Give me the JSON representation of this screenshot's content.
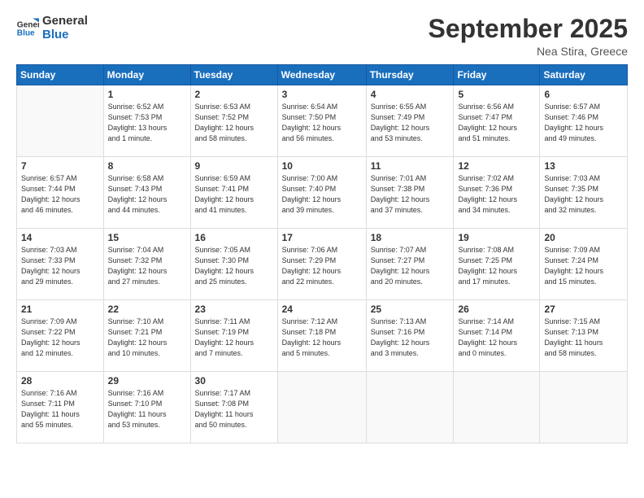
{
  "header": {
    "logo_line1": "General",
    "logo_line2": "Blue",
    "month": "September 2025",
    "location": "Nea Stira, Greece"
  },
  "weekdays": [
    "Sunday",
    "Monday",
    "Tuesday",
    "Wednesday",
    "Thursday",
    "Friday",
    "Saturday"
  ],
  "weeks": [
    [
      {
        "day": "",
        "info": ""
      },
      {
        "day": "1",
        "info": "Sunrise: 6:52 AM\nSunset: 7:53 PM\nDaylight: 13 hours\nand 1 minute."
      },
      {
        "day": "2",
        "info": "Sunrise: 6:53 AM\nSunset: 7:52 PM\nDaylight: 12 hours\nand 58 minutes."
      },
      {
        "day": "3",
        "info": "Sunrise: 6:54 AM\nSunset: 7:50 PM\nDaylight: 12 hours\nand 56 minutes."
      },
      {
        "day": "4",
        "info": "Sunrise: 6:55 AM\nSunset: 7:49 PM\nDaylight: 12 hours\nand 53 minutes."
      },
      {
        "day": "5",
        "info": "Sunrise: 6:56 AM\nSunset: 7:47 PM\nDaylight: 12 hours\nand 51 minutes."
      },
      {
        "day": "6",
        "info": "Sunrise: 6:57 AM\nSunset: 7:46 PM\nDaylight: 12 hours\nand 49 minutes."
      }
    ],
    [
      {
        "day": "7",
        "info": "Sunrise: 6:57 AM\nSunset: 7:44 PM\nDaylight: 12 hours\nand 46 minutes."
      },
      {
        "day": "8",
        "info": "Sunrise: 6:58 AM\nSunset: 7:43 PM\nDaylight: 12 hours\nand 44 minutes."
      },
      {
        "day": "9",
        "info": "Sunrise: 6:59 AM\nSunset: 7:41 PM\nDaylight: 12 hours\nand 41 minutes."
      },
      {
        "day": "10",
        "info": "Sunrise: 7:00 AM\nSunset: 7:40 PM\nDaylight: 12 hours\nand 39 minutes."
      },
      {
        "day": "11",
        "info": "Sunrise: 7:01 AM\nSunset: 7:38 PM\nDaylight: 12 hours\nand 37 minutes."
      },
      {
        "day": "12",
        "info": "Sunrise: 7:02 AM\nSunset: 7:36 PM\nDaylight: 12 hours\nand 34 minutes."
      },
      {
        "day": "13",
        "info": "Sunrise: 7:03 AM\nSunset: 7:35 PM\nDaylight: 12 hours\nand 32 minutes."
      }
    ],
    [
      {
        "day": "14",
        "info": "Sunrise: 7:03 AM\nSunset: 7:33 PM\nDaylight: 12 hours\nand 29 minutes."
      },
      {
        "day": "15",
        "info": "Sunrise: 7:04 AM\nSunset: 7:32 PM\nDaylight: 12 hours\nand 27 minutes."
      },
      {
        "day": "16",
        "info": "Sunrise: 7:05 AM\nSunset: 7:30 PM\nDaylight: 12 hours\nand 25 minutes."
      },
      {
        "day": "17",
        "info": "Sunrise: 7:06 AM\nSunset: 7:29 PM\nDaylight: 12 hours\nand 22 minutes."
      },
      {
        "day": "18",
        "info": "Sunrise: 7:07 AM\nSunset: 7:27 PM\nDaylight: 12 hours\nand 20 minutes."
      },
      {
        "day": "19",
        "info": "Sunrise: 7:08 AM\nSunset: 7:25 PM\nDaylight: 12 hours\nand 17 minutes."
      },
      {
        "day": "20",
        "info": "Sunrise: 7:09 AM\nSunset: 7:24 PM\nDaylight: 12 hours\nand 15 minutes."
      }
    ],
    [
      {
        "day": "21",
        "info": "Sunrise: 7:09 AM\nSunset: 7:22 PM\nDaylight: 12 hours\nand 12 minutes."
      },
      {
        "day": "22",
        "info": "Sunrise: 7:10 AM\nSunset: 7:21 PM\nDaylight: 12 hours\nand 10 minutes."
      },
      {
        "day": "23",
        "info": "Sunrise: 7:11 AM\nSunset: 7:19 PM\nDaylight: 12 hours\nand 7 minutes."
      },
      {
        "day": "24",
        "info": "Sunrise: 7:12 AM\nSunset: 7:18 PM\nDaylight: 12 hours\nand 5 minutes."
      },
      {
        "day": "25",
        "info": "Sunrise: 7:13 AM\nSunset: 7:16 PM\nDaylight: 12 hours\nand 3 minutes."
      },
      {
        "day": "26",
        "info": "Sunrise: 7:14 AM\nSunset: 7:14 PM\nDaylight: 12 hours\nand 0 minutes."
      },
      {
        "day": "27",
        "info": "Sunrise: 7:15 AM\nSunset: 7:13 PM\nDaylight: 11 hours\nand 58 minutes."
      }
    ],
    [
      {
        "day": "28",
        "info": "Sunrise: 7:16 AM\nSunset: 7:11 PM\nDaylight: 11 hours\nand 55 minutes."
      },
      {
        "day": "29",
        "info": "Sunrise: 7:16 AM\nSunset: 7:10 PM\nDaylight: 11 hours\nand 53 minutes."
      },
      {
        "day": "30",
        "info": "Sunrise: 7:17 AM\nSunset: 7:08 PM\nDaylight: 11 hours\nand 50 minutes."
      },
      {
        "day": "",
        "info": ""
      },
      {
        "day": "",
        "info": ""
      },
      {
        "day": "",
        "info": ""
      },
      {
        "day": "",
        "info": ""
      }
    ]
  ]
}
